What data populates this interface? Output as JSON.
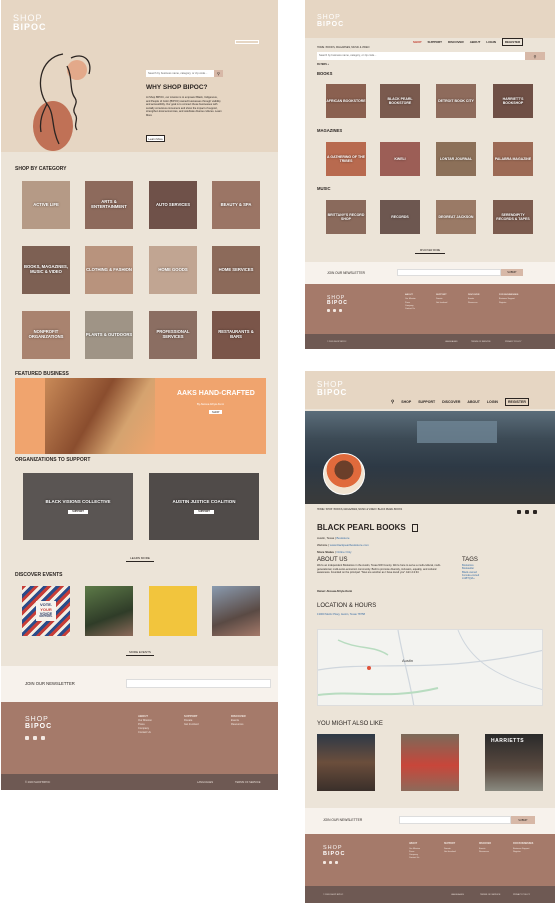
{
  "brand": {
    "line1": "SHOP",
    "line2": "BIPOC"
  },
  "nav": {
    "shop": "SHOP",
    "support": "SUPPORT",
    "discover": "DISCOVER",
    "about": "ABOUT",
    "login": "LOGIN",
    "register": "REGISTER"
  },
  "home": {
    "search_placeholder": "Search by business name, category, or zip code...",
    "why_title": "WHY SHOP BIPOC?",
    "why_body": "At Shop BIPOC, our mission is to empower Black, Indigenous, and People of Color (BIPOC) owned businesses through visibility and accessibility. Our goal is to connect these businesses with socially conscious consumers and show the impact of support, strengthen local economies, and celebrate diverse cultures. Learn More",
    "learn_more": "Learn More",
    "shop_by_category": "SHOP BY CATEGORY",
    "categories": [
      "ACTIVE LIFE",
      "ARTS & ENTERTAINMENT",
      "AUTO SERVICES",
      "BEAUTY & SPA",
      "BOOKS, MAGAZINES, MUSIC & VIDEO",
      "CLOTHING & FASHION",
      "HOME GOODS",
      "HOME SERVICES",
      "NONPROFIT ORGANIZATIONS",
      "PLANTS & OUTDOORS",
      "PROFESSIONAL SERVICES",
      "RESTAURANTS & BARS"
    ],
    "featured_title": "FEATURED BUSINESS",
    "featured_name": "AAKS HAND-CRAFTED",
    "featured_sub": "By Akosua Afriyie-Kumi",
    "featured_btn": "SHOP",
    "orgs_title": "ORGANIZATIONS TO SUPPORT",
    "orgs": [
      {
        "name": "BLACK VISIONS COLLECTIVE",
        "btn": "SUPPORT"
      },
      {
        "name": "AUSTIN JUSTICE COALITION",
        "btn": "SUPPORT"
      }
    ],
    "learn_more_btn": "LEARN MORE",
    "events_title": "DISCOVER EVENTS",
    "vote_sign": [
      "VOTE.",
      "YOUR",
      "VOICE",
      "MATTERS."
    ],
    "more_events": "MORE EVENTS"
  },
  "books": {
    "breadcrumb": "HOME / BOOKS, MAGAZINES, MUSIC & VIDEO",
    "search_placeholder": "Search by business name, category, or zip code...",
    "filters": "FILTERS +",
    "sections": [
      {
        "title": "BOOKS",
        "items": [
          "AFRICAN BOOKSTORE",
          "BLACK PEARL BOOKSTORE",
          "DETROIT BOOK CITY",
          "HARRIETT'S BOOKSHOP"
        ]
      },
      {
        "title": "MAGAZINES",
        "items": [
          "A GATHERING OF THE TRIBES",
          "KWELI",
          "LONTAR JOURNAL",
          "PALABRA MAGAZINE"
        ]
      },
      {
        "title": "MUSIC",
        "items": [
          "BRITTANY'S RECORD SHOP",
          "RECORDS",
          "DEGREAT JACKSON",
          "SERENDIPITY RECORDS & TAPES"
        ]
      }
    ],
    "discover_more": "DISCOVER MORE"
  },
  "detail": {
    "breadcrumb": "HOME / SHOP / BOOKS, MAGAZINES, MUSIC & VIDEO / BLACK PEARL BOOKS",
    "name": "BLACK PEARL BOOKS",
    "location": "Austin, Texas",
    "type": "Bookstore",
    "website_label": "Website",
    "website": "www.blackpearlbookstore.com",
    "store_status": "Store Status",
    "online_only": "Online Only",
    "about_title": "ABOUT US",
    "about_body": "We're an independent Bookstore in the Austin, Texas NW County. We're here to serve a multi-cultural, multi-generational, multi-socio-economic community. Built to promote diversity, inclusion, equality, and cultural awareness. Founded on the principal: \"Now ere another as I have loved you\" John 13:34",
    "owner": "Owner: Akosua Afriyie-Kumi",
    "tags_title": "TAGS",
    "tags": [
      "Bookstore",
      "Bookseller",
      "Black-owned",
      "Female-owned",
      "LGBTQIA+"
    ],
    "location_title": "LOCATION & HOURS",
    "address": "13000 Metric Pkwy, Austin, Texas 78758",
    "map_label": "Austin",
    "also_like": "YOU MIGHT ALSO LIKE",
    "harriets_sign": "HARRIETTS"
  },
  "newsletter": {
    "label": "JOIN OUR NEWSLETTER",
    "submit": "SUBMIT"
  },
  "footer": {
    "cols": [
      {
        "title": "ABOUT",
        "items": [
          "Our Mission",
          "Press",
          "Company",
          "Contact Us"
        ]
      },
      {
        "title": "SUPPORT",
        "items": [
          "Donate",
          "Get Involved"
        ]
      },
      {
        "title": "DISCOVER",
        "items": [
          "Events",
          "Resources"
        ]
      },
      {
        "title": "FOR BUSINESSES",
        "items": [
          "Business Support",
          "Register"
        ]
      }
    ],
    "copyright": "© 2020 SHOP BIPOC",
    "languages": "LANGUAGES",
    "terms": "TERMS OF SERVICE",
    "privacy": "PRIVACY POLICY"
  },
  "colors": {
    "bg": "#ece4d8",
    "footer": "#a57a6a",
    "footbar": "#6e5953",
    "accent": "#2b2522",
    "featured": "#f0a46e"
  }
}
